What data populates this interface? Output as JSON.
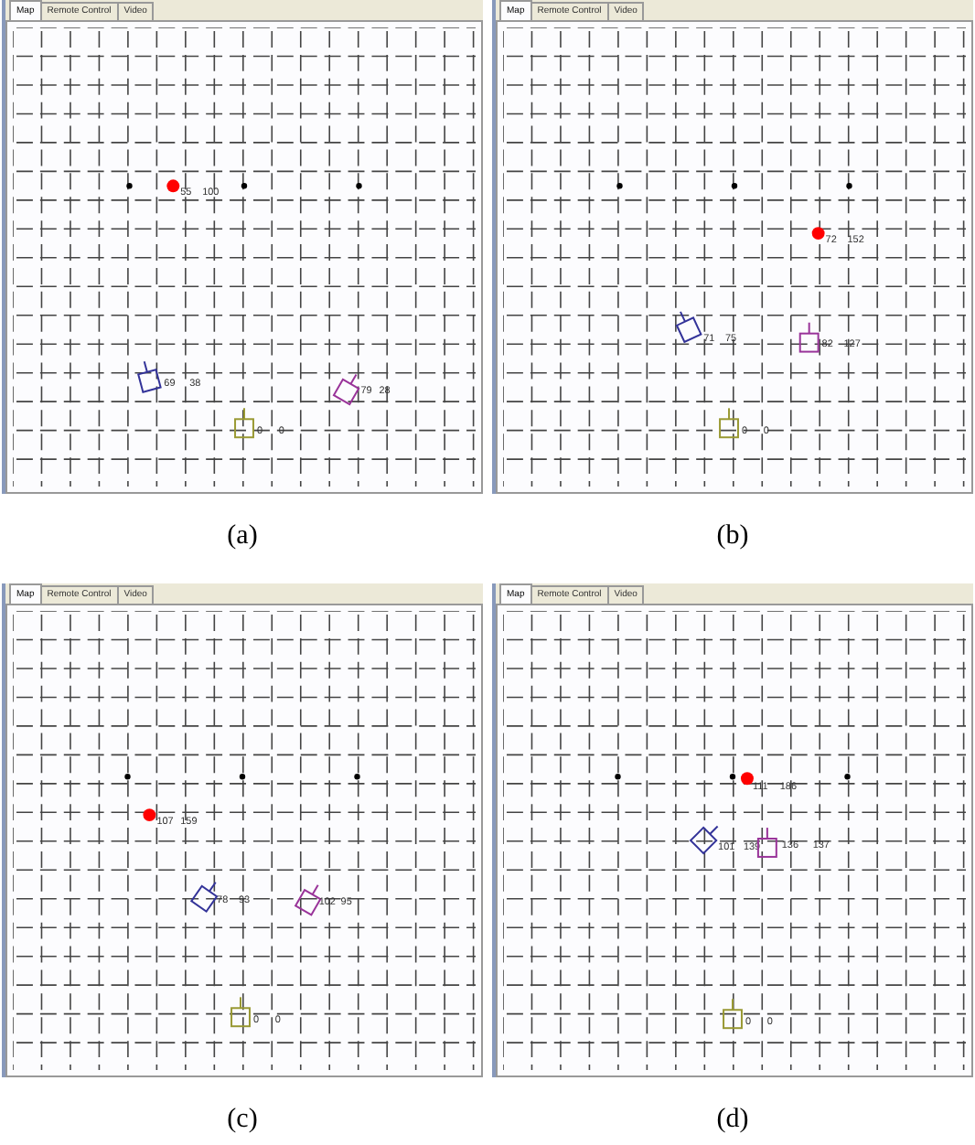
{
  "panels": [
    {
      "tabs": [
        {
          "label": "Map",
          "selected": true
        },
        {
          "label": "Remote Control",
          "selected": false
        },
        {
          "label": "Video",
          "selected": false
        }
      ],
      "objects": [
        {
          "kind": "ball",
          "color": "#ff0000",
          "labels": [
            "55",
            "100"
          ]
        },
        {
          "kind": "robot",
          "color": "#333399",
          "labels": [
            "69",
            "38"
          ]
        },
        {
          "kind": "robot",
          "color": "#993399",
          "labels": [
            "79",
            "28"
          ]
        },
        {
          "kind": "robot",
          "color": "#999933",
          "labels": [
            "0",
            "0"
          ]
        }
      ],
      "caption": "(a)"
    },
    {
      "tabs": [
        {
          "label": "Map",
          "selected": true
        },
        {
          "label": "Remote Control",
          "selected": false
        },
        {
          "label": "Video",
          "selected": false
        }
      ],
      "objects": [
        {
          "kind": "ball",
          "color": "#ff0000",
          "labels": [
            "72",
            "152"
          ]
        },
        {
          "kind": "robot",
          "color": "#333399",
          "labels": [
            "71",
            "75"
          ]
        },
        {
          "kind": "robot",
          "color": "#993399",
          "labels": [
            "82",
            "127"
          ]
        },
        {
          "kind": "robot",
          "color": "#999933",
          "labels": [
            "0",
            "0"
          ]
        }
      ],
      "caption": "(b)"
    },
    {
      "tabs": [
        {
          "label": "Map",
          "selected": true
        },
        {
          "label": "Remote Control",
          "selected": false
        },
        {
          "label": "Video",
          "selected": false
        }
      ],
      "objects": [
        {
          "kind": "ball",
          "color": "#ff0000",
          "labels": [
            "107",
            "159"
          ]
        },
        {
          "kind": "robot",
          "color": "#333399",
          "labels": [
            "78",
            "93"
          ]
        },
        {
          "kind": "robot",
          "color": "#993399",
          "labels": [
            "102",
            "95"
          ]
        },
        {
          "kind": "robot",
          "color": "#999933",
          "labels": [
            "0",
            "0"
          ]
        }
      ],
      "caption": "(c)"
    },
    {
      "tabs": [
        {
          "label": "Map",
          "selected": true
        },
        {
          "label": "Remote Control",
          "selected": false
        },
        {
          "label": "Video",
          "selected": false
        }
      ],
      "objects": [
        {
          "kind": "ball",
          "color": "#ff0000",
          "labels": [
            "111",
            "186"
          ]
        },
        {
          "kind": "robot",
          "color": "#333399",
          "labels": [
            "101",
            "139"
          ]
        },
        {
          "kind": "robot",
          "color": "#993399",
          "labels": [
            "136",
            "137"
          ]
        },
        {
          "kind": "robot",
          "color": "#999933",
          "labels": [
            "0",
            "0"
          ]
        }
      ],
      "caption": "(d)"
    }
  ]
}
